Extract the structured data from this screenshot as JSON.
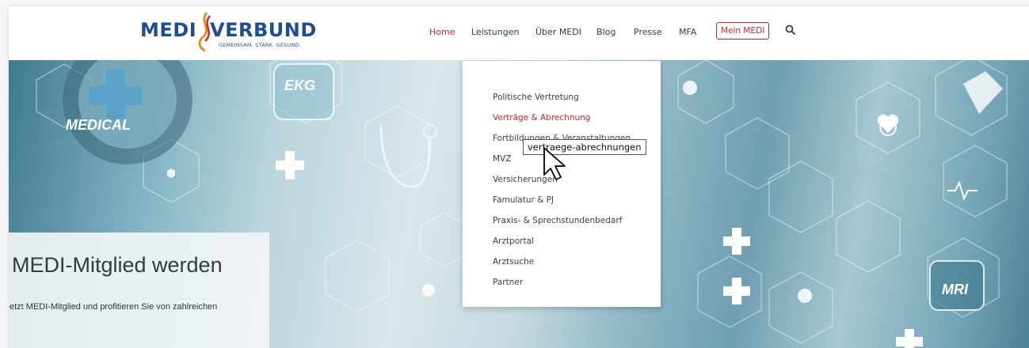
{
  "logo": {
    "left": "MEDI",
    "right": "VERBUND",
    "tagline": "GEMEINSAM. STARK. GESUND.",
    "brand_color": "#1f4d8f",
    "accent_color": "#d1262f"
  },
  "nav": {
    "items": [
      "Home",
      "Leistungen",
      "Über MEDI",
      "Blog",
      "Presse",
      "MFA"
    ],
    "active_index": 0,
    "member_button": "Mein MEDI",
    "search_icon": "search-icon"
  },
  "dropdown": {
    "items": [
      "Politische Vertretung",
      "Verträge & Abrechnung",
      "Fortbildungen & Veranstaltungen",
      "MVZ",
      "Versicherungen",
      "Famulatur & PJ",
      "Praxis- & Sprechstundenbedarf",
      "Arztportal",
      "Arztsuche",
      "Partner"
    ],
    "hovered_index": 1
  },
  "tooltip": "vertraege-abrechnungen",
  "hero": {
    "labels": [
      "MEDICAL",
      "EKG",
      "MRI"
    ],
    "cta_title": "MEDI-Mitglied werden",
    "cta_text": "etzt MEDI-Mitglied und profitieren Sie von zahlreichen"
  }
}
